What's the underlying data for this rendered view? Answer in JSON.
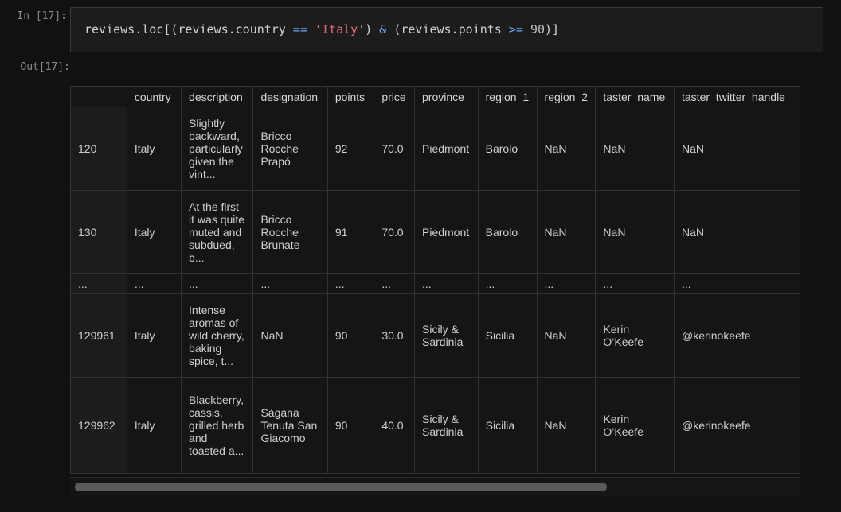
{
  "input_prompt": "In [17]:",
  "output_prompt": "Out[17]:",
  "code": {
    "tokens": [
      {
        "text": "reviews",
        "kind": "plain"
      },
      {
        "text": ".",
        "kind": "plain"
      },
      {
        "text": "loc",
        "kind": "plain"
      },
      {
        "text": "[(",
        "kind": "plain"
      },
      {
        "text": "reviews",
        "kind": "plain"
      },
      {
        "text": ".",
        "kind": "plain"
      },
      {
        "text": "country ",
        "kind": "plain"
      },
      {
        "text": "==",
        "kind": "op"
      },
      {
        "text": " ",
        "kind": "plain"
      },
      {
        "text": "'Italy'",
        "kind": "str"
      },
      {
        "text": ") ",
        "kind": "plain"
      },
      {
        "text": "&",
        "kind": "op"
      },
      {
        "text": " (",
        "kind": "plain"
      },
      {
        "text": "reviews",
        "kind": "plain"
      },
      {
        "text": ".",
        "kind": "plain"
      },
      {
        "text": "points ",
        "kind": "plain"
      },
      {
        "text": ">=",
        "kind": "op"
      },
      {
        "text": " ",
        "kind": "plain"
      },
      {
        "text": "90",
        "kind": "num"
      },
      {
        "text": ")]",
        "kind": "plain"
      }
    ]
  },
  "table": {
    "columns": [
      "",
      "country",
      "description",
      "designation",
      "points",
      "price",
      "province",
      "region_1",
      "region_2",
      "taster_name",
      "taster_twitter_handle"
    ],
    "rows": [
      {
        "cls": "tall",
        "cells": [
          "120",
          "Italy",
          "Slightly backward, particularly given the vint...",
          "Bricco Rocche Prapó",
          "92",
          "70.0",
          "Piedmont",
          "Barolo",
          "NaN",
          "NaN",
          "NaN"
        ]
      },
      {
        "cls": "tall",
        "cells": [
          "130",
          "Italy",
          "At the first it was quite muted and subdued, b...",
          "Bricco Rocche Brunate",
          "91",
          "70.0",
          "Piedmont",
          "Barolo",
          "NaN",
          "NaN",
          "NaN"
        ]
      },
      {
        "cls": "ellipsis",
        "cells": [
          "...",
          "...",
          "...",
          "...",
          "...",
          "...",
          "...",
          "...",
          "...",
          "...",
          "..."
        ]
      },
      {
        "cls": "tall",
        "cells": [
          "129961",
          "Italy",
          "Intense aromas of wild cherry, baking spice, t...",
          "NaN",
          "90",
          "30.0",
          "Sicily & Sardinia",
          "Sicilia",
          "NaN",
          "Kerin O’Keefe",
          "@kerinokeefe"
        ]
      },
      {
        "cls": "tall2",
        "cells": [
          "129962",
          "Italy",
          "Blackberry, cassis, grilled herb and toasted a...",
          "Sàgana Tenuta San Giacomo",
          "90",
          "40.0",
          "Sicily & Sardinia",
          "Sicilia",
          "NaN",
          "Kerin O’Keefe",
          "@kerinokeefe"
        ]
      }
    ]
  },
  "colors": {
    "background": "#111111",
    "code_bg": "#1c1c1c",
    "operator": "#6ea7ff",
    "string": "#e06c75"
  }
}
